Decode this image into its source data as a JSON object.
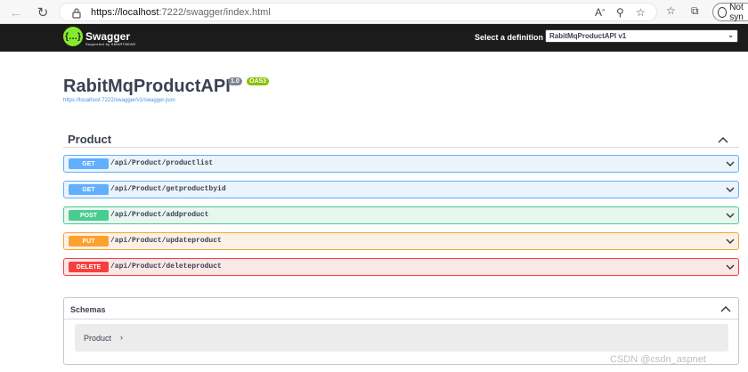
{
  "browser": {
    "url_host": "https://localhost",
    "url_path": ":7222/swagger/index.html",
    "sync_label": "Not syn"
  },
  "topbar": {
    "logo_text": "Swagger",
    "logo_sub": "Supported by SMARTBEAR",
    "definition_label": "Select a definition",
    "definition_value": "RabitMqProductAPI v1"
  },
  "info": {
    "title": "RabitMqProductAPI",
    "version": "1.0",
    "oas": "OAS3",
    "spec_link": "https://localhost:7222/swagger/v1/swagger.json"
  },
  "tag": {
    "name": "Product"
  },
  "operations": [
    {
      "method": "GET",
      "path": "/api/Product/productlist"
    },
    {
      "method": "GET",
      "path": "/api/Product/getproductbyid"
    },
    {
      "method": "POST",
      "path": "/api/Product/addproduct"
    },
    {
      "method": "PUT",
      "path": "/api/Product/updateproduct"
    },
    {
      "method": "DELETE",
      "path": "/api/Product/deleteproduct"
    }
  ],
  "schemas": {
    "title": "Schemas",
    "models": [
      {
        "name": "Product"
      }
    ]
  },
  "watermark": "CSDN @csdn_aspnet"
}
